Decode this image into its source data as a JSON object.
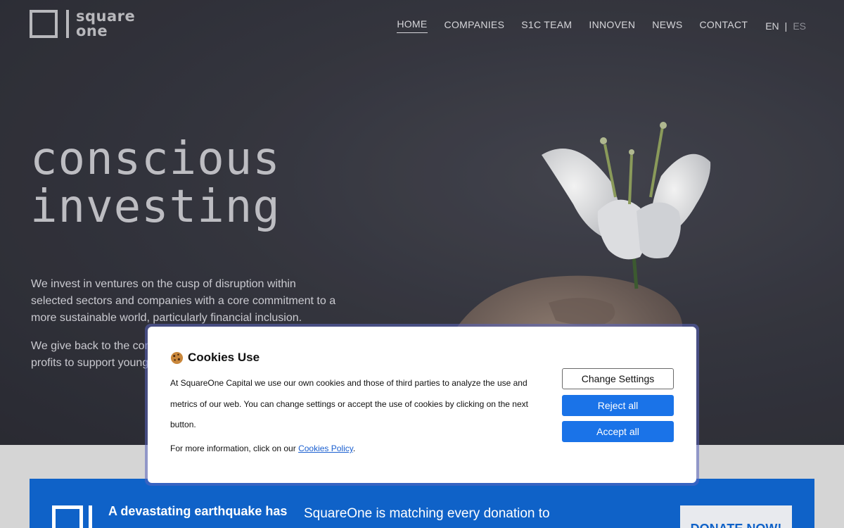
{
  "brand": {
    "logo_line1": "square",
    "logo_line2": "one"
  },
  "nav": {
    "items": [
      {
        "label": "HOME",
        "active": true
      },
      {
        "label": "COMPANIES",
        "active": false
      },
      {
        "label": "S1C TEAM",
        "active": false
      },
      {
        "label": "INNOVEN",
        "active": false
      },
      {
        "label": "NEWS",
        "active": false
      },
      {
        "label": "CONTACT",
        "active": false
      }
    ],
    "lang_en": "EN",
    "lang_sep": "|",
    "lang_es": "ES"
  },
  "hero": {
    "headline_line1": "conscious",
    "headline_line2": "investing",
    "para1": "We invest in ventures on the cusp of disruption within selected sectors and companies with a core commitment to a more sustainable world, particularly financial inclusion.",
    "para2": "We give back to the community, allocating a share of our profits to support young and underprivileged entrepreneurs."
  },
  "band": {
    "title": "A devastating earthquake has",
    "text": "SquareOne is matching every donation to",
    "donate_label": "DONATE NOW!"
  },
  "cookie_modal": {
    "title": "Cookies Use",
    "body": "At SquareOne Capital we use our own cookies and those of third parties to analyze the use and metrics of our web. You can change settings or accept the use of cookies by clicking on the next button.",
    "more_prefix": "For more information, click on our ",
    "more_link": "Cookies Policy",
    "more_suffix": ".",
    "change_settings_label": "Change Settings",
    "reject_label": "Reject all",
    "accept_label": "Accept all"
  },
  "colors": {
    "hero_bg": "#33343d",
    "band_blue": "#0f62c8",
    "button_blue": "#1a73e8",
    "link_blue": "#1a5fd0"
  }
}
